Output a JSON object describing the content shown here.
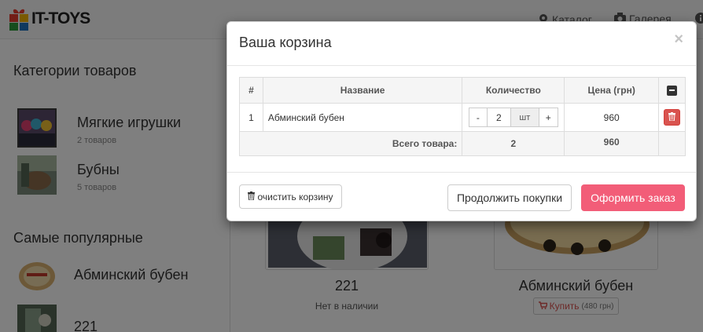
{
  "brand": {
    "logo_text": "IT-TOYS"
  },
  "nav": {
    "catalog_label": "Каталог",
    "gallery_label": "Галерея"
  },
  "sidebar": {
    "categories_heading": "Категории товаров",
    "categories": [
      {
        "name": "Мягкие игрушки",
        "count": "2 товаров"
      },
      {
        "name": "Бубны",
        "count": "5 товаров"
      }
    ],
    "popular_heading": "Самые популярные",
    "popular": [
      {
        "name": "Абминский бубен"
      },
      {
        "name": "221"
      }
    ]
  },
  "products": [
    {
      "title": "221",
      "status": "Нет в наличии"
    },
    {
      "title": "Абминский бубен",
      "buy_label": "Купить",
      "price_note": "(480 грн)"
    }
  ],
  "modal": {
    "title": "Ваша корзина",
    "close_label": "×",
    "table": {
      "headers": {
        "num": "#",
        "name": "Название",
        "qty": "Количество",
        "price": "Цена (грн)"
      },
      "rows": [
        {
          "num": "1",
          "name": "Абминский бубен",
          "minus": "-",
          "qty": "2",
          "unit": "шт",
          "plus": "+",
          "price": "960"
        }
      ],
      "total": {
        "label": "Всего товара:",
        "qty": "2",
        "price": "960"
      }
    },
    "footer": {
      "clear_label": "очистить корзину",
      "continue_label": "Продолжить покупки",
      "checkout_label": "Оформить заказ"
    }
  },
  "colors": {
    "checkout_button": "#f25d78",
    "delete_button": "#d9534f",
    "buy_text": "#d9534f"
  },
  "icons": {
    "clear": "trash-icon",
    "delete": "trash-icon",
    "header_action": "minus-square-icon",
    "buy": "cart-icon",
    "catalog": "gear-icon",
    "gallery": "camera-icon"
  }
}
